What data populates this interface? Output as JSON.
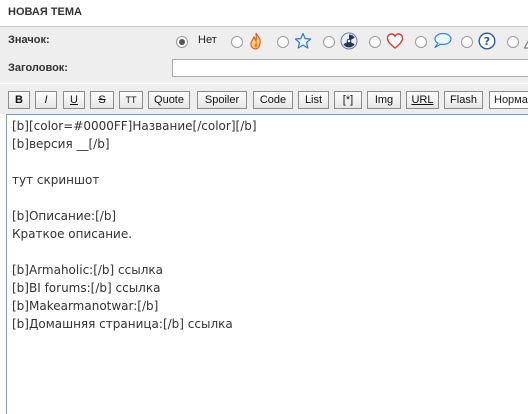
{
  "header": {
    "title": "НОВАЯ ТЕМА"
  },
  "icon_row": {
    "label": "Значок:",
    "options": [
      {
        "icon": "none",
        "text": "Нет",
        "selected": true
      },
      {
        "icon": "fire-icon",
        "selected": false
      },
      {
        "icon": "star-icon",
        "selected": false
      },
      {
        "icon": "radiation-icon",
        "selected": false
      },
      {
        "icon": "heart-icon",
        "selected": false
      },
      {
        "icon": "speech-bubble-icon",
        "selected": false
      },
      {
        "icon": "question-icon",
        "selected": false
      },
      {
        "icon": "warning-icon",
        "selected": false
      }
    ]
  },
  "subject_row": {
    "label": "Заголовок:",
    "value": ""
  },
  "toolbar": {
    "buttons": [
      "B",
      "I",
      "U",
      "S",
      "TT",
      "Quote",
      "Spoiler",
      "Code",
      "List",
      "[*]",
      "Img",
      "URL",
      "Flash"
    ],
    "font_size_select": "Нормальный"
  },
  "editor": {
    "lines": [
      "[b][color=#0000FF]Название[/color][/b]",
      "[b]версия __[/b]",
      "",
      "тут скриншот",
      "",
      "[b]Описание:[/b]",
      "Краткое описание.",
      "",
      "[b]Armaholic:[/b] ссылка",
      "[b]BI forums:[/b] ссылка",
      "[b]Makearmanotwar:[/b]",
      "[b]Домашняя страница:[/b] ссылка"
    ]
  },
  "colors": {
    "accent": "#3366cc",
    "panel": "#eeeeee",
    "editor_border": "#7a9cc8"
  }
}
